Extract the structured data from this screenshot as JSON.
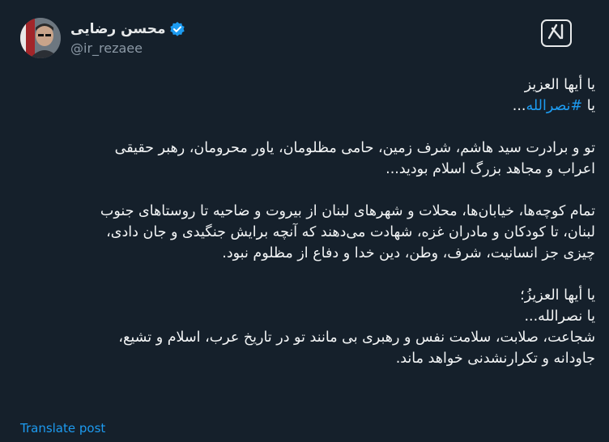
{
  "author": {
    "name": "محسن رضایی",
    "handle": "@ir_rezaee",
    "verified": true
  },
  "post": {
    "line1": "یا أیها العزیز",
    "line2_prefix": "یا ",
    "hashtag": "#نصرالله",
    "line2_suffix": "...",
    "p1_line1": "تو و برادرت سید هاشم، شرف زمین، حامی مظلومان، یاور محرومان، رهبر حقیقی",
    "p1_line2": "اعراب و مجاهد بزرگ اسلام بودید...",
    "p2_line1": "تمام کوچه‌ها، خیابان‌ها، محلات و شهرهای لبنان از بیروت و ضاحیه تا روستاهای جنوب",
    "p2_line2": "لبنان، تا کودکان و مادران غزه، شهادت می‌دهند که آنچه برایش جنگیدی و جان دادی،",
    "p2_line3": "چیزی جز انسانیت، شرف، وطن، دین خدا و دفاع از مظلوم نبود.",
    "p3_line1": "یا أیها العزیزُ؛",
    "p3_line2": "یا نصرالله...",
    "p3_line3": "شجاعت، صلابت، سلامت نفس و رهبری بی مانند تو در تاریخ عرب، اسلام و تشیع،",
    "p3_line4": "جاودانه و تکرارنشدنی خواهد ماند."
  },
  "translate_label": "Translate post",
  "colors": {
    "background": "#15202b",
    "link": "#1d9bf0",
    "secondary_text": "#8b98a5",
    "verified_badge": "#1d9bf0"
  },
  "icons": {
    "verified": "verified-badge-icon",
    "grok": "grok-icon"
  }
}
